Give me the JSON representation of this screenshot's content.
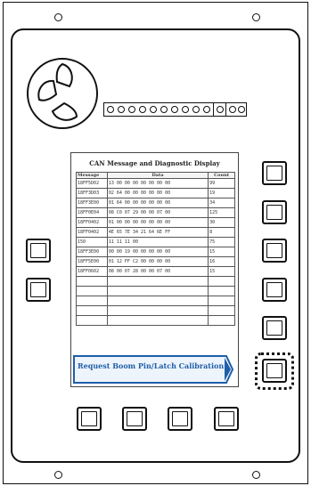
{
  "display": {
    "title": "CAN Message and Diagnostic Display",
    "columns": [
      "Message",
      "Data",
      "Count"
    ],
    "rows": [
      {
        "message": "18FF5D02",
        "data": "13 00 00 00 00 00 00 00",
        "count": "99"
      },
      {
        "message": "18FF3D03",
        "data": "02 64 00 00 00 00 00 00",
        "count": "19"
      },
      {
        "message": "18FF3E00",
        "data": "01 64 00 00 00 00 00 00",
        "count": "34"
      },
      {
        "message": "18FF0E04",
        "data": "08 C0 07 29 00 00 07 00",
        "count": "125"
      },
      {
        "message": "18FF0402",
        "data": "01 00 00 00 00 00 00 00",
        "count": "30"
      },
      {
        "message": "18FF0402",
        "data": "4E 65 7E 34 21 64 6E FF",
        "count": "8"
      },
      {
        "message": "150",
        "data": "11 11 11 00",
        "count": "75"
      },
      {
        "message": "18FF3E00",
        "data": "00 00 19 00 00 00 00 00",
        "count": "15"
      },
      {
        "message": "18FF5E00",
        "data": "01 12 FF C2 00 00 00 00",
        "count": "16"
      },
      {
        "message": "18FF0602",
        "data": "08 00 07 28 00 00 07 00",
        "count": "15"
      },
      {
        "message": "",
        "data": "",
        "count": ""
      },
      {
        "message": "",
        "data": "",
        "count": ""
      },
      {
        "message": "",
        "data": "",
        "count": ""
      },
      {
        "message": "",
        "data": "",
        "count": ""
      },
      {
        "message": "",
        "data": "",
        "count": ""
      }
    ]
  },
  "banner": {
    "label": "Request Boom Pin/Latch Calibration"
  },
  "colors": {
    "banner_blue": "#1f5fa8",
    "banner_fill": "#eef4fc",
    "frame": "#111111"
  }
}
